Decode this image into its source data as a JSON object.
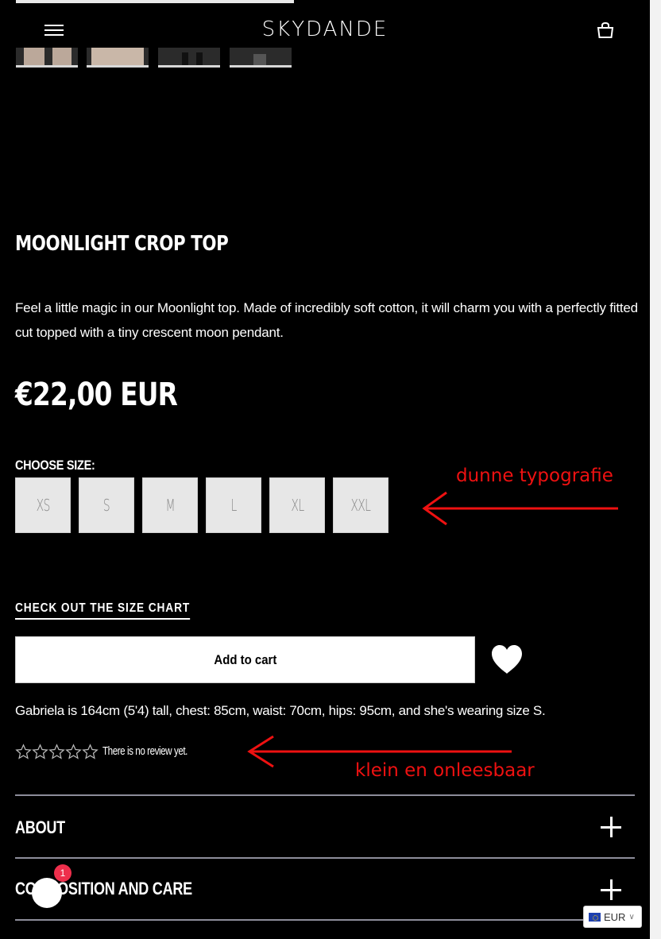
{
  "header": {
    "logo": "SKYDANDE",
    "menu_icon": "hamburger-menu-icon",
    "cart_icon": "shopping-bag-icon"
  },
  "product": {
    "title": "MOONLIGHT CROP TOP",
    "description": "Feel a little magic in our Moonlight top. Made of incredibly soft cotton, it will charm you with a perfectly fitted cut topped with a tiny crescent moon pendant.",
    "price": "€22,00 EUR",
    "size_label": "CHOOSE SIZE:",
    "sizes": [
      "XS",
      "S",
      "M",
      "L",
      "XL",
      "XXL"
    ],
    "size_chart_link": "CHECK OUT THE SIZE CHART",
    "add_to_cart": "Add to cart",
    "wishlist_icon": "heart-icon",
    "model_info": "Gabriela is 164cm (5'4) tall, chest: 85cm, waist: 70cm, hips: 95cm, and she's wearing size S.",
    "rating_stars": 0,
    "rating_max": 5,
    "review_text": "There is no review yet."
  },
  "accordion": [
    {
      "label": "ABOUT"
    },
    {
      "label": "COMPOSITION AND CARE"
    }
  ],
  "annotations": {
    "sizes_note": "dunne typografie",
    "reviews_note": "klein en onleesbaar",
    "color": "#e11111"
  },
  "chat": {
    "badge_count": "1"
  },
  "currency": {
    "code": "EUR"
  }
}
